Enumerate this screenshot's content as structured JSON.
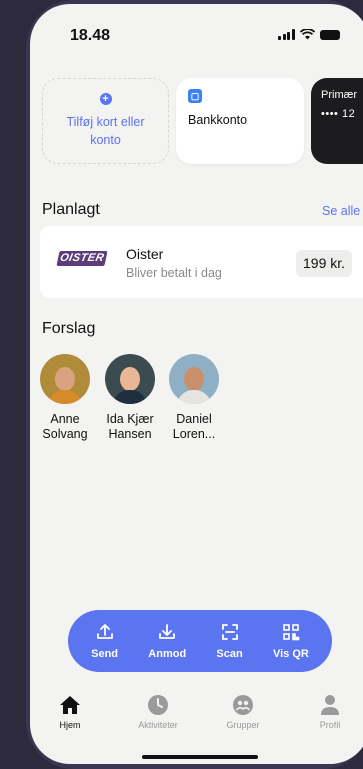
{
  "status_bar": {
    "time": "18.48"
  },
  "cards": {
    "add_label": "Tilføj kort eller konto",
    "bank_label": "Bankkonto",
    "dark_title": "Primær",
    "dark_number": "•••• 12"
  },
  "planned": {
    "title": "Planlagt",
    "see_all": "Se alle",
    "item": {
      "logo_text": "OISTER",
      "name": "Oister",
      "subtitle": "Bliver betalt i dag",
      "amount": "199 kr."
    }
  },
  "suggestions": {
    "title": "Forslag",
    "people": [
      {
        "name": "Anne Solvang",
        "skin": "#d9a37f",
        "shirt": "#d68a2a",
        "bg": "#b08b3a"
      },
      {
        "name": "Ida Kjær Hansen",
        "skin": "#e9b796",
        "shirt": "#1f2f3f",
        "bg": "#3b4b4f"
      },
      {
        "name": "Daniel Loren...",
        "skin": "#c98f6a",
        "shirt": "#e6e4e0",
        "bg": "#8fb0c4"
      }
    ]
  },
  "actions": [
    {
      "label": "Send",
      "icon": "upload-icon"
    },
    {
      "label": "Anmod",
      "icon": "download-icon"
    },
    {
      "label": "Scan",
      "icon": "scan-icon"
    },
    {
      "label": "Vis QR",
      "icon": "qr-icon"
    }
  ],
  "tabs": [
    {
      "label": "Hjem",
      "icon": "home-icon",
      "active": true
    },
    {
      "label": "Aktiviteter",
      "icon": "clock-icon",
      "active": false
    },
    {
      "label": "Grupper",
      "icon": "group-icon",
      "active": false
    },
    {
      "label": "Profil",
      "icon": "profile-icon",
      "active": false
    }
  ],
  "colors": {
    "accent": "#5b74f0",
    "background": "#f3f3f1",
    "frame": "#2e2a3d"
  }
}
